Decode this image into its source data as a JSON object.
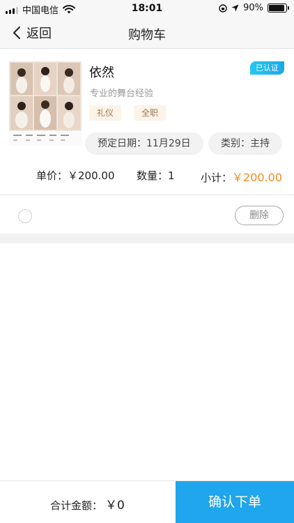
{
  "status_bar": {
    "carrier": "中国电信",
    "time": "18:01",
    "battery": "90%",
    "battery_level": 0.9
  },
  "nav": {
    "back_label": "返回",
    "title": "购物车"
  },
  "item": {
    "name": "依然",
    "verified_badge": "已认证",
    "description": "专业的舞台经验",
    "tags": [
      "礼仪",
      "全职"
    ],
    "booking_date": "预定日期：11月29日",
    "category": "类别：主持",
    "unit_price_label": "单价：",
    "unit_price": "￥200.00",
    "quantity_label": "数量：",
    "quantity": "1",
    "subtotal_label": "小计：",
    "subtotal": "￥200.00",
    "delete_label": "删除"
  },
  "footer": {
    "total_label": "合计金额：",
    "total_value": "￥0",
    "confirm_label": "确认下单"
  },
  "colors": {
    "accent": "#1fa6ec",
    "price": "#f08a22",
    "tag_bg": "#fdf3e8"
  }
}
